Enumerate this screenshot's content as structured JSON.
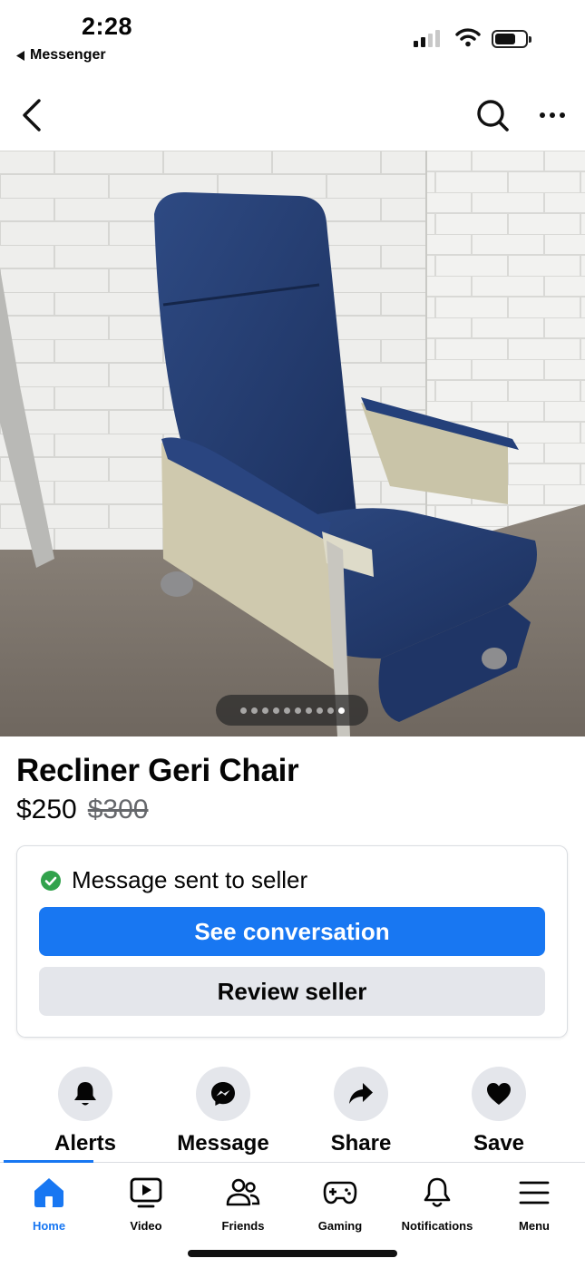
{
  "status_bar": {
    "time": "2:28",
    "back_app": "Messenger"
  },
  "listing": {
    "title": "Recliner Geri Chair",
    "price": "$250",
    "original_price": "$300",
    "photo_count": 10,
    "current_photo": 10
  },
  "message_card": {
    "status": "Message sent to seller",
    "see_conversation": "See conversation",
    "review_seller": "Review seller"
  },
  "actions": [
    {
      "label": "Alerts",
      "icon": "bell-icon"
    },
    {
      "label": "Message",
      "icon": "messenger-icon"
    },
    {
      "label": "Share",
      "icon": "share-arrow-icon"
    },
    {
      "label": "Save",
      "icon": "heart-icon"
    }
  ],
  "tabs": [
    {
      "label": "Home",
      "icon": "home-icon",
      "active": true
    },
    {
      "label": "Video",
      "icon": "video-icon"
    },
    {
      "label": "Friends",
      "icon": "friends-icon"
    },
    {
      "label": "Gaming",
      "icon": "gaming-icon"
    },
    {
      "label": "Notifications",
      "icon": "notifications-icon"
    },
    {
      "label": "Menu",
      "icon": "menu-icon"
    }
  ],
  "colors": {
    "accent": "#1877f2",
    "success": "#31a24c",
    "secondary_button": "#e4e6eb"
  }
}
